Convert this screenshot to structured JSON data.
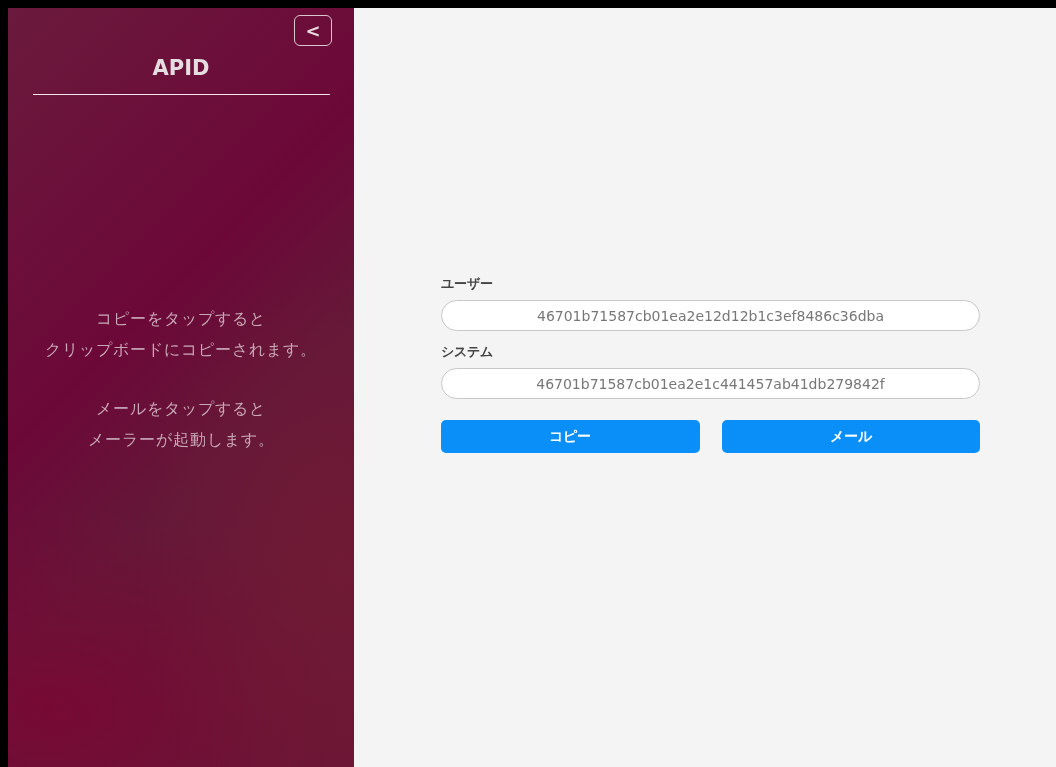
{
  "sidebar": {
    "back_button": {
      "label": "<"
    },
    "title": "APID",
    "help": [
      [
        "コピーをタップすると",
        "クリップボードにコピーされます。"
      ],
      [
        "メールをタップすると",
        "メーラーが起動します。"
      ]
    ]
  },
  "fields": [
    {
      "label": "ユーザー",
      "value": "46701b71587cb01ea2e12d12b1c3ef8486c36dba"
    },
    {
      "label": "システム",
      "value": "46701b71587cb01ea2e1c441457ab41db279842f"
    }
  ],
  "buttons": [
    "コピー",
    "メール"
  ]
}
